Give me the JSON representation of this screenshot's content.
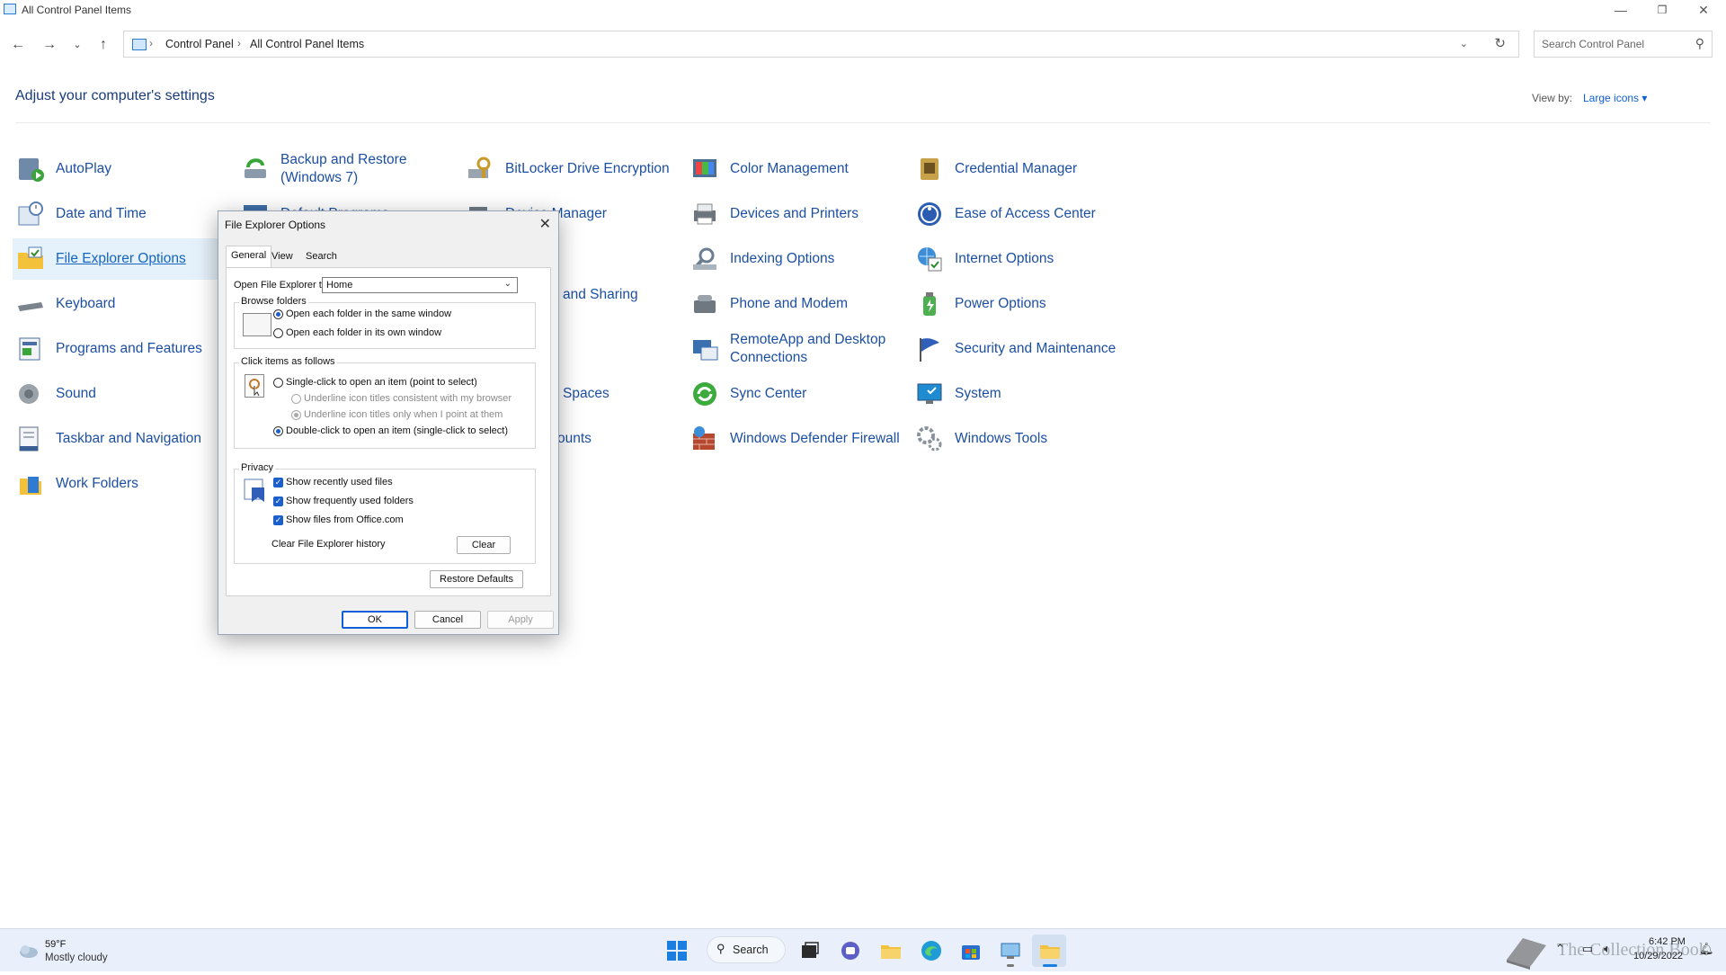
{
  "window": {
    "title": "All Control Panel Items"
  },
  "nav": {
    "breadcrumbs": [
      "Control Panel",
      "All Control Panel Items"
    ],
    "search_placeholder": "Search Control Panel"
  },
  "header": {
    "title": "Adjust your computer's settings",
    "view_by_label": "View by:",
    "view_by_value": "Large icons"
  },
  "items": [
    {
      "label": "AutoPlay",
      "icon": "autoplay-icon"
    },
    {
      "label": "Backup and Restore (Windows 7)",
      "icon": "backup-icon"
    },
    {
      "label": "BitLocker Drive Encryption",
      "icon": "bitlocker-icon"
    },
    {
      "label": "Color Management",
      "icon": "color-management-icon"
    },
    {
      "label": "Credential Manager",
      "icon": "credential-manager-icon"
    },
    {
      "label": "Date and Time",
      "icon": "date-time-icon"
    },
    {
      "label": "Default Programs",
      "icon": "default-programs-icon"
    },
    {
      "label": "Device Manager",
      "icon": "device-manager-icon"
    },
    {
      "label": "Devices and Printers",
      "icon": "devices-printers-icon"
    },
    {
      "label": "Ease of Access Center",
      "icon": "ease-of-access-icon"
    },
    {
      "label": "File Explorer Options",
      "icon": "file-explorer-options-icon"
    },
    {
      "label": "Indexing Options",
      "icon": "indexing-icon"
    },
    {
      "label": "Internet Options",
      "icon": "internet-options-icon"
    },
    {
      "label": "Keyboard",
      "icon": "keyboard-icon"
    },
    {
      "label": "and Sharing",
      "icon": "network-sharing-icon"
    },
    {
      "label": "Phone and Modem",
      "icon": "phone-modem-icon"
    },
    {
      "label": "Power Options",
      "icon": "power-options-icon"
    },
    {
      "label": "Programs and Features",
      "icon": "programs-features-icon"
    },
    {
      "label": "RemoteApp and Desktop Connections",
      "icon": "remoteapp-icon"
    },
    {
      "label": "Security and Maintenance",
      "icon": "security-flag-icon"
    },
    {
      "label": "Sound",
      "icon": "sound-icon"
    },
    {
      "label": "Spaces",
      "icon": "storage-spaces-icon"
    },
    {
      "label": "Sync Center",
      "icon": "sync-center-icon"
    },
    {
      "label": "System",
      "icon": "system-icon"
    },
    {
      "label": "Taskbar and Navigation",
      "icon": "taskbar-icon"
    },
    {
      "label": "ounts",
      "icon": "user-accounts-icon"
    },
    {
      "label": "Windows Defender Firewall",
      "icon": "firewall-icon"
    },
    {
      "label": "Windows Tools",
      "icon": "windows-tools-icon"
    },
    {
      "label": "Work Folders",
      "icon": "work-folders-icon"
    }
  ],
  "dialog": {
    "title": "File Explorer Options",
    "tabs": [
      "General",
      "View",
      "Search"
    ],
    "open_to_label": "Open File Explorer to:",
    "open_to_value": "Home",
    "browse_title": "Browse folders",
    "browse_same": "Open each folder in the same window",
    "browse_own": "Open each folder in its own window",
    "click_title": "Click items as follows",
    "single_click": "Single-click to open an item (point to select)",
    "underline_browser": "Underline icon titles consistent with my browser",
    "underline_point": "Underline icon titles only when I point at them",
    "double_click": "Double-click to open an item (single-click to select)",
    "privacy_title": "Privacy",
    "recent_files": "Show recently used files",
    "frequent_folders": "Show frequently used folders",
    "office_files": "Show files from Office.com",
    "clear_history_label": "Clear File Explorer history",
    "clear_button": "Clear",
    "restore_button": "Restore Defaults",
    "ok_button": "OK",
    "cancel_button": "Cancel",
    "apply_button": "Apply"
  },
  "taskbar": {
    "weather_temp": "59°F",
    "weather_desc": "Mostly cloudy",
    "search_label": "Search",
    "time": "6:42 PM",
    "date": "10/29/2022",
    "watermark": "The Collection Book"
  },
  "colors": {
    "accent": "#0f5fd6",
    "link": "#1c4fa3",
    "taskbar": "#e9f0fb"
  }
}
